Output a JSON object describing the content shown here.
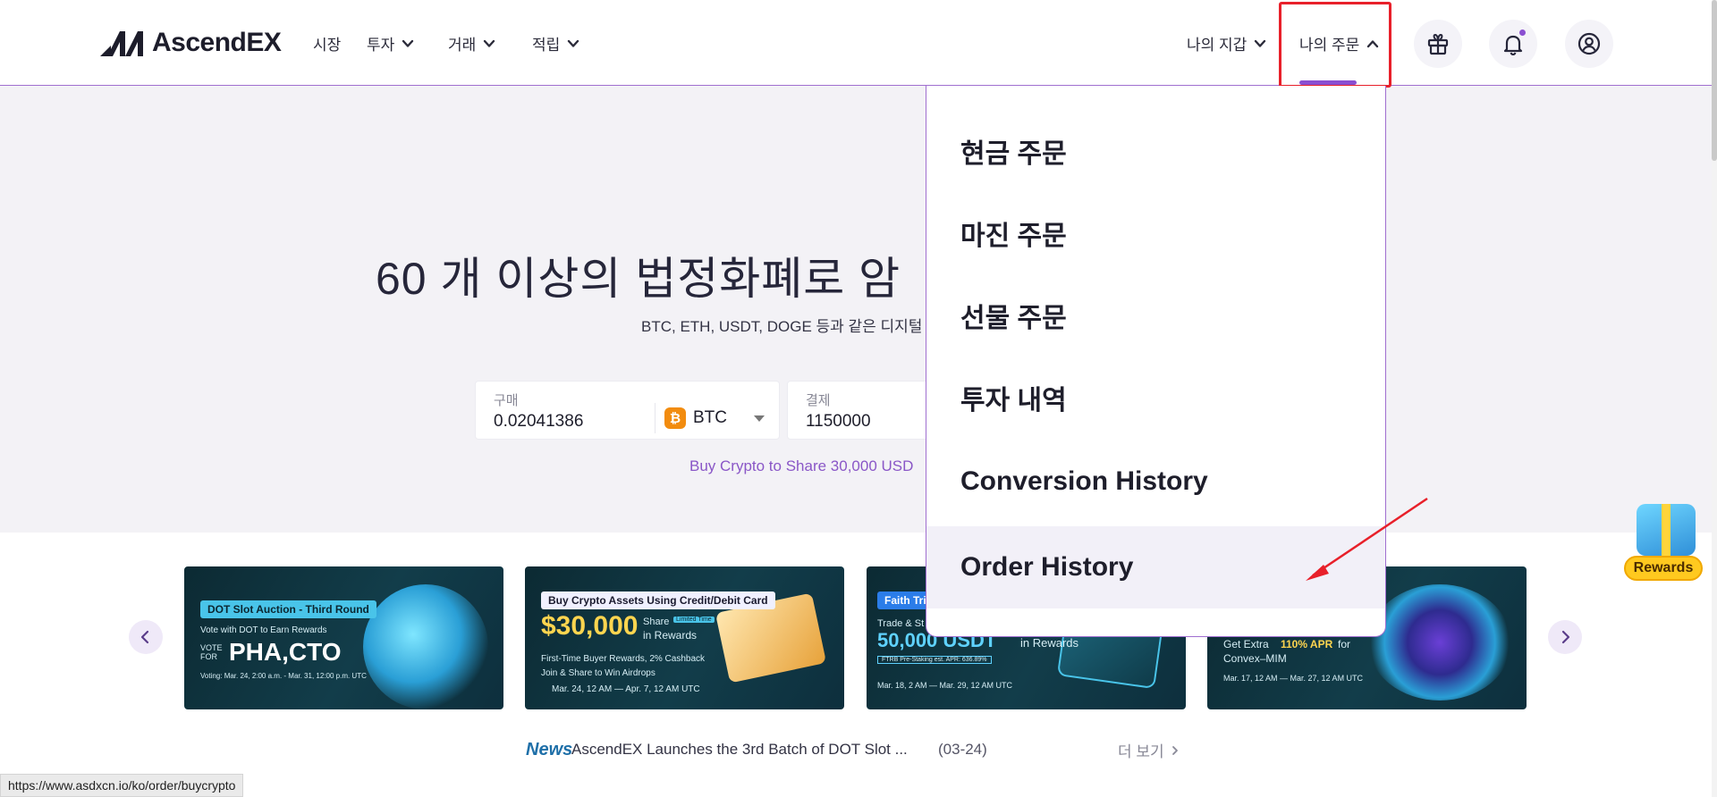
{
  "brand": {
    "name": "AscendEX"
  },
  "nav": {
    "market": "시장",
    "invest": "투자",
    "trade": "거래",
    "earn": "적립",
    "wallet": "나의 지갑",
    "orders": "나의 주문"
  },
  "header_icons": [
    "gift-icon",
    "bell-icon",
    "user-icon"
  ],
  "hero": {
    "title": "60 개 이상의 법정화폐로 암",
    "subtitle": "BTC, ETH, USDT, DOGE 등과 같은 디지털",
    "buy": {
      "label": "구매",
      "value": "0.02041386",
      "coin": "BTC",
      "coin_glyph": "₿"
    },
    "pay": {
      "label": "결제",
      "value": "1150000"
    },
    "promo": "Buy Crypto to Share 30,000 USD"
  },
  "dropdown": {
    "items": [
      "현금 주문",
      "마진 주문",
      "선물 주문",
      "투자 내역",
      "Conversion History",
      "Order History"
    ],
    "active_index": 5
  },
  "banners": [
    {
      "tag": "DOT Slot Auction - Third Round",
      "line1": "Vote with DOT to Earn Rewards",
      "vote_label": "VOTE FOR",
      "big": "PHA,CTO",
      "date": "Voting: Mar. 24, 2:00 a.m. - Mar. 31, 12:00 p.m. UTC"
    },
    {
      "tag": "Buy Crypto Assets Using Credit/Debit Card",
      "big": "$30,000",
      "share": "Share",
      "limited": "Limited Time",
      "in_rewards": "in Rewards",
      "line1": "First-Time Buyer Rewards, 2% Cashback",
      "line2": "Join & Share to Win Airdrops",
      "date": "Mar. 24, 12 AM — Apr. 7, 12 AM UTC"
    },
    {
      "tag": "Faith Trib",
      "line1": "Trade & St",
      "big": "50,000 USDT",
      "in_rewards": "in Rewards",
      "line2": "FTRB Pre-Staking est. APR: 636.89%",
      "date": "Mar. 18, 2 AM — Mar. 29, 12 AM UTC"
    },
    {
      "line1": "Get Extra",
      "apr": "110% APR",
      "line1b": "for",
      "line2": "Convex–MIM",
      "date": "Mar. 17, 12 AM — Mar. 27, 12 AM UTC"
    }
  ],
  "news": {
    "tag": "News",
    "headline": "AscendEX Launches the 3rd Batch of DOT Slot ...",
    "date": "(03-24)",
    "more": "더 보기"
  },
  "rewards": {
    "label": "Rewards"
  },
  "status_url": "https://www.asdxcn.io/ko/order/buycrypto",
  "colors": {
    "accent": "#8a4fd1",
    "highlight": "#e8202a",
    "hero_bg": "#f3f2f6",
    "dropdown_active": "#f2f0f8"
  }
}
